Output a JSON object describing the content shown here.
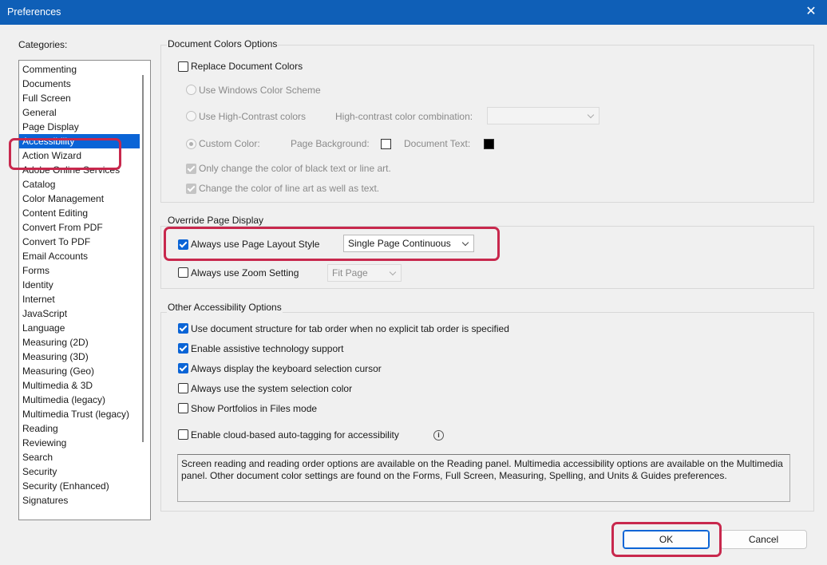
{
  "window": {
    "title": "Preferences",
    "close_glyph": "✕"
  },
  "categories": {
    "label": "Categories:",
    "items": [
      "Commenting",
      "Documents",
      "Full Screen",
      "General",
      "Page Display",
      "Accessibility",
      "Action Wizard",
      "Adobe Online Services",
      "Catalog",
      "Color Management",
      "Content Editing",
      "Convert From PDF",
      "Convert To PDF",
      "Email Accounts",
      "Forms",
      "Identity",
      "Internet",
      "JavaScript",
      "Language",
      "Measuring (2D)",
      "Measuring (3D)",
      "Measuring (Geo)",
      "Multimedia & 3D",
      "Multimedia (legacy)",
      "Multimedia Trust (legacy)",
      "Reading",
      "Reviewing",
      "Search",
      "Security",
      "Security (Enhanced)",
      "Signatures"
    ],
    "selected": "Accessibility"
  },
  "doc_colors": {
    "title": "Document Colors Options",
    "replace_label": "Replace Document Colors",
    "windows_scheme_label": "Use Windows Color Scheme",
    "high_contrast_label": "Use High-Contrast colors",
    "hc_combination_label": "High-contrast color combination:",
    "custom_color_label": "Custom Color:",
    "page_background_label": "Page Background:",
    "page_background_color": "#ffffff",
    "document_text_label": "Document Text:",
    "document_text_color": "#000000",
    "only_black_label": "Only change the color of black text or line art.",
    "line_art_label": "Change the color of line art as well as text."
  },
  "override": {
    "title": "Override Page Display",
    "layout_style_label": "Always use Page Layout Style",
    "layout_style_value": "Single Page Continuous",
    "zoom_label": "Always use Zoom Setting",
    "zoom_value": "Fit Page"
  },
  "other": {
    "title": "Other Accessibility Options",
    "tab_order_label": "Use document structure for tab order when no explicit tab order is specified",
    "assistive_label": "Enable assistive technology support",
    "keyboard_cursor_label": "Always display the keyboard selection cursor",
    "system_color_label": "Always use the system selection color",
    "portfolios_label": "Show Portfolios in Files mode",
    "cloud_tagging_label": "Enable cloud-based auto-tagging for accessibility",
    "info_glyph": "i",
    "info_text": "Screen reading and reading order options are available on the Reading panel. Multimedia accessibility options are available on the Multimedia panel. Other document color settings are found on the Forms, Full Screen, Measuring, Spelling, and Units & Guides preferences."
  },
  "buttons": {
    "ok": "OK",
    "cancel": "Cancel"
  },
  "highlight_color": "#c8284d",
  "accent_color": "#0a64d6"
}
